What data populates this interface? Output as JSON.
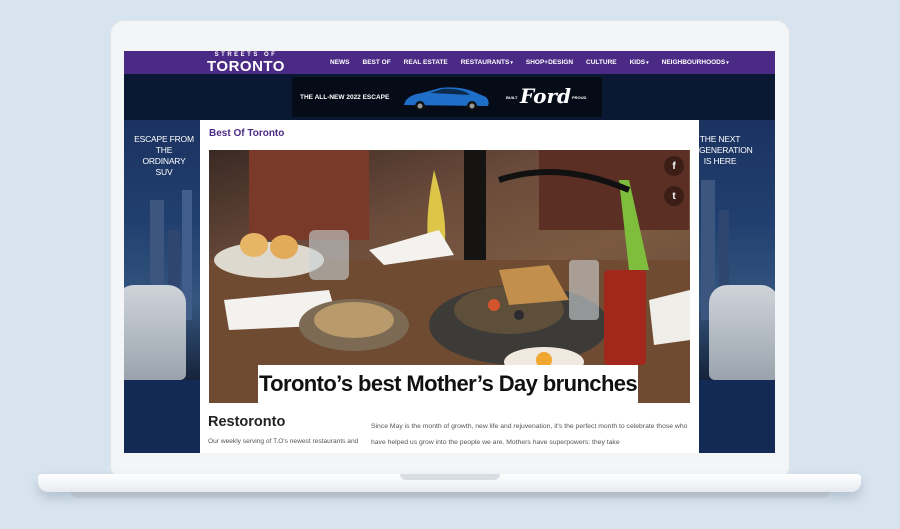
{
  "site": {
    "logo_top": "STREETS OF",
    "logo_main": "TORONTO"
  },
  "nav": {
    "items": [
      {
        "label": "NEWS",
        "dropdown": false
      },
      {
        "label": "BEST OF",
        "dropdown": false
      },
      {
        "label": "REAL ESTATE",
        "dropdown": false
      },
      {
        "label": "RESTAURANTS",
        "dropdown": true
      },
      {
        "label": "SHOP+DESIGN",
        "dropdown": false
      },
      {
        "label": "CULTURE",
        "dropdown": false
      },
      {
        "label": "KIDS",
        "dropdown": true
      },
      {
        "label": "NEIGHBOURHOODS",
        "dropdown": true
      }
    ],
    "caret": "▾"
  },
  "ad_banner": {
    "headline": "THE ALL-NEW 2022 ESCAPE",
    "built": "BUILT",
    "brand": "Ford",
    "proud": "PROUD"
  },
  "side_ads": {
    "left_text": "ESCAPE FROM THE ORDINARY SUV",
    "right_text": "THE NEXT GENERATION IS HERE"
  },
  "article": {
    "section": "Best Of Toronto",
    "hero_title": "Toronto’s best Mother’s Day brunches",
    "share_icons": [
      "f",
      "t"
    ],
    "sub_title": "Restoronto",
    "sub_desc": "Our weekly serving of T.O's newest restaurants and",
    "body": "Since May is the month of growth, new life and rejuvenation, it's the perfect month to celebrate those who have helped us grow into the people we are. Mothers have superpowers: they take"
  },
  "colors": {
    "brand_purple": "#4b2a86",
    "page_dark": "#0f1f3e"
  }
}
